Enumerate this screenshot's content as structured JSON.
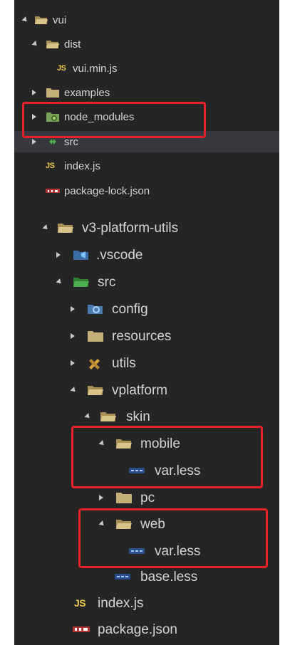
{
  "explorer": {
    "upper": {
      "vui": "vui",
      "dist": "dist",
      "vui_min_js": "vui.min.js",
      "examples": "examples",
      "node_modules": "node_modules",
      "src": "src",
      "index_js": "index.js",
      "package_lock_json": "package-lock.json"
    },
    "lower": {
      "v3_platform_utils": "v3-platform-utils",
      "vscode": ".vscode",
      "src": "src",
      "config": "config",
      "resources": "resources",
      "utils": "utils",
      "vplatform": "vplatform",
      "skin": "skin",
      "mobile": "mobile",
      "mobile_var_less": "var.less",
      "pc": "pc",
      "web": "web",
      "web_var_less": "var.less",
      "base_less": "base.less",
      "index_js": "index.js",
      "package_json": "package.json"
    },
    "js_badge": "JS"
  },
  "colors": {
    "background": "#252526",
    "selected_row": "#37373d",
    "folder": "#c5b07a",
    "js": "#e8c84a",
    "highlight_box": "#e8222a"
  }
}
